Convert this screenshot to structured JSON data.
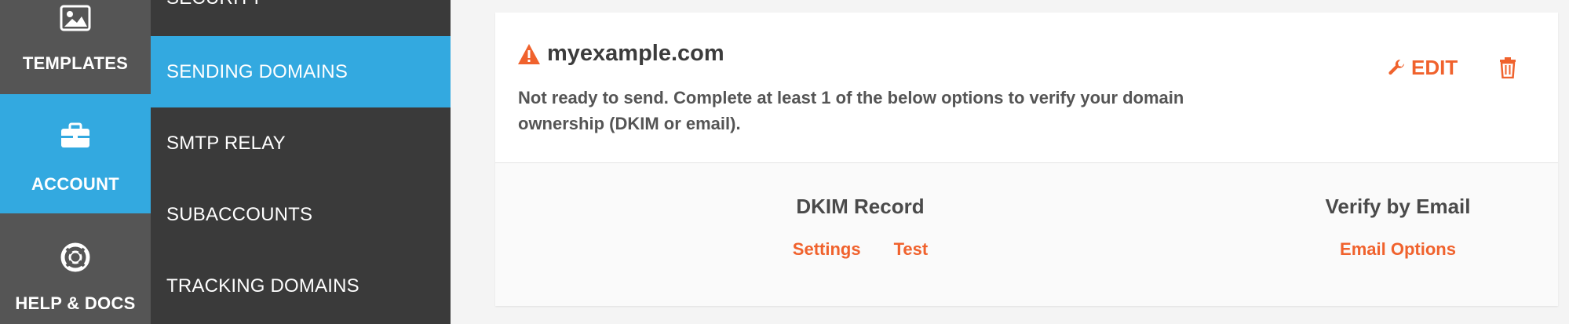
{
  "rail": {
    "templates_label": "TEMPLATES",
    "account_label": "ACCOUNT",
    "help_label": "HELP & DOCS",
    "active_color": "#33a9e0"
  },
  "submenu": {
    "items": [
      {
        "label": "SECURITY"
      },
      {
        "label": "SENDING DOMAINS",
        "active": true
      },
      {
        "label": "SMTP RELAY"
      },
      {
        "label": "SUBACCOUNTS"
      },
      {
        "label": "TRACKING DOMAINS"
      }
    ]
  },
  "domain": {
    "name": "myexample.com",
    "status_icon": "warning-icon",
    "status_message": "Not ready to send. Complete at least 1 of the below options to verify your domain ownership (DKIM or email).",
    "edit_label": "EDIT",
    "edit_icon": "wrench-icon",
    "delete_icon": "trash-icon",
    "accent_color": "#f0622d"
  },
  "verification": {
    "dkim": {
      "title": "DKIM Record",
      "links": [
        "Settings",
        "Test"
      ]
    },
    "email": {
      "title": "Verify by Email",
      "links": [
        "Email Options"
      ]
    }
  }
}
